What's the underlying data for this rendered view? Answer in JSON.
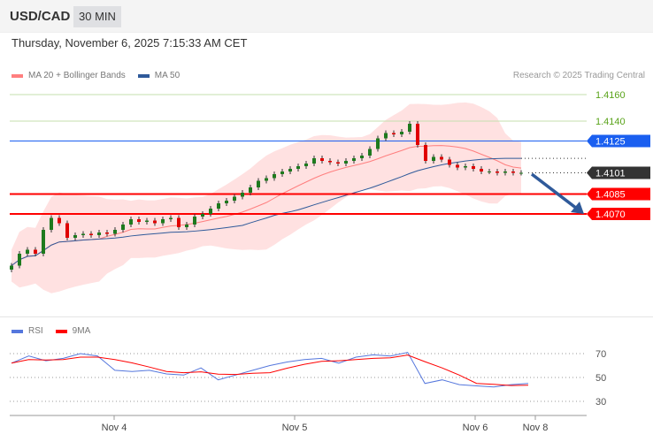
{
  "header": {
    "symbol": "USD/CAD",
    "timeframe": "30 MIN"
  },
  "timestamp": "Thursday, November 6, 2025 7:15:33 AM CET",
  "legend": {
    "ma20": "MA 20 + Bollinger Bands",
    "ma50": "MA 50",
    "rsi": "RSI",
    "rsi_ma": "9MA"
  },
  "copyright": "Research © 2025 Trading Central",
  "colors": {
    "ma20": "#ff7f7f",
    "ma50": "#2f5a9a",
    "resistance": "#1a5ff0",
    "support": "#ff0000",
    "last": "#333333",
    "target": "#5aa31a",
    "rsi": "#5577dd",
    "rsi_ma": "#ff0000"
  },
  "levels": [
    {
      "label": "1.4160",
      "value": 1.416,
      "type": "target"
    },
    {
      "label": "1.4140",
      "value": 1.414,
      "type": "target"
    },
    {
      "label": "1.4125",
      "value": 1.4125,
      "type": "resistance"
    },
    {
      "label": "1.4101",
      "value": 1.4101,
      "type": "last"
    },
    {
      "label": "1.4085",
      "value": 1.4085,
      "type": "support"
    },
    {
      "label": "1.4070",
      "value": 1.407,
      "type": "support"
    }
  ],
  "chart_data": {
    "type": "candlestick",
    "closes": [
      1.4031,
      1.404,
      1.4043,
      1.404,
      1.4058,
      1.4067,
      1.4063,
      1.4052,
      1.4054,
      1.4055,
      1.4054,
      1.4056,
      1.4055,
      1.4058,
      1.4062,
      1.4066,
      1.4064,
      1.4065,
      1.4063,
      1.4066,
      1.4067,
      1.406,
      1.4062,
      1.4068,
      1.407,
      1.4074,
      1.4078,
      1.408,
      1.4083,
      1.4086,
      1.409,
      1.4095,
      1.4097,
      1.41,
      1.4102,
      1.4104,
      1.4106,
      1.4108,
      1.4112,
      1.411,
      1.4109,
      1.4108,
      1.411,
      1.4112,
      1.4114,
      1.4119,
      1.4127,
      1.4131,
      1.413,
      1.4132,
      1.4138,
      1.4122,
      1.411,
      1.4113,
      1.4111,
      1.4107,
      1.4105,
      1.4106,
      1.4104,
      1.4102,
      1.4102,
      1.4101,
      1.4102,
      1.4101,
      1.4101
    ],
    "rsi": [
      62,
      68,
      64,
      66,
      70,
      68,
      56,
      55,
      56,
      53,
      52,
      58,
      48,
      52,
      56,
      60,
      63,
      65,
      66,
      62,
      67,
      69,
      68,
      71,
      45,
      48,
      44,
      43,
      42,
      44,
      45
    ],
    "rsi_levels": [
      {
        "label": "70",
        "value": 70
      },
      {
        "label": "50",
        "value": 50
      },
      {
        "label": "30",
        "value": 30
      }
    ],
    "x_ticks": [
      {
        "label": "Nov 4"
      },
      {
        "label": "Nov 5"
      },
      {
        "label": "Nov 6"
      },
      {
        "label": "Nov 8"
      }
    ],
    "ylim": [
      1.4,
      1.4175
    ]
  }
}
